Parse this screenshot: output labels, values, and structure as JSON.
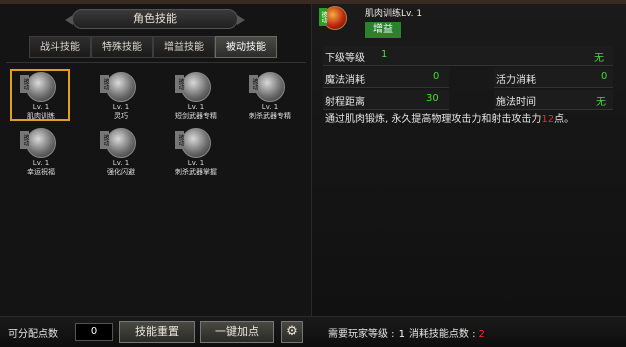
{
  "window": {
    "title": "角色技能"
  },
  "tabs": [
    {
      "label": "战斗技能",
      "active": false
    },
    {
      "label": "特殊技能",
      "active": false
    },
    {
      "label": "增益技能",
      "active": false
    },
    {
      "label": "被动技能",
      "active": true
    }
  ],
  "badge_text": "被动",
  "skills": [
    {
      "level": "Lv. 1",
      "name": "肌肉训练",
      "icon": "fist-icon",
      "selected": true
    },
    {
      "level": "Lv. 1",
      "name": "灵巧",
      "icon": "glove-icon",
      "selected": false
    },
    {
      "level": "Lv. 1",
      "name": "短剑武器专精",
      "icon": "dagger-icon",
      "selected": false
    },
    {
      "level": "Lv. 1",
      "name": "刺杀武器专精",
      "icon": "claw-icon",
      "selected": false
    },
    {
      "level": "Lv. 1",
      "name": "幸运祝福",
      "icon": "blessing-icon",
      "selected": false
    },
    {
      "level": "Lv. 1",
      "name": "强化闪避",
      "icon": "dodge-icon",
      "selected": false
    },
    {
      "level": "Lv. 1",
      "name": "刺杀武器掌握",
      "icon": "mastery-icon",
      "selected": false
    }
  ],
  "detail": {
    "badge": "被动",
    "name": "肌肉训练Lv. 1",
    "tag": "增益",
    "next_level_label": "下级等级",
    "next_level_value": "1",
    "next_level_right": "无",
    "mana_label": "魔法消耗",
    "mana_value": "0",
    "vigor_label": "活力消耗",
    "vigor_value": "0",
    "range_label": "射程距离",
    "range_value": "30",
    "cast_label": "施法时间",
    "cast_value": "无",
    "desc_main": "通过肌肉锻炼, 永久提高物理攻击力和射击攻击力",
    "desc_num": "12",
    "desc_tail": "点。"
  },
  "footer": {
    "points_label": "可分配点数",
    "points_value": "0",
    "reset_label": "技能重置",
    "one_click_label": "一键加点",
    "gear_icon": "gear-icon",
    "req_label": "需要玩家等级 :",
    "req_value": "1",
    "cost_label": "消耗技能点数 :",
    "cost_value": "2"
  },
  "colors": {
    "green": "#4bd840",
    "red": "#e03030",
    "select_gold": "#e0a020",
    "tag_green": "#2f7f2f"
  }
}
